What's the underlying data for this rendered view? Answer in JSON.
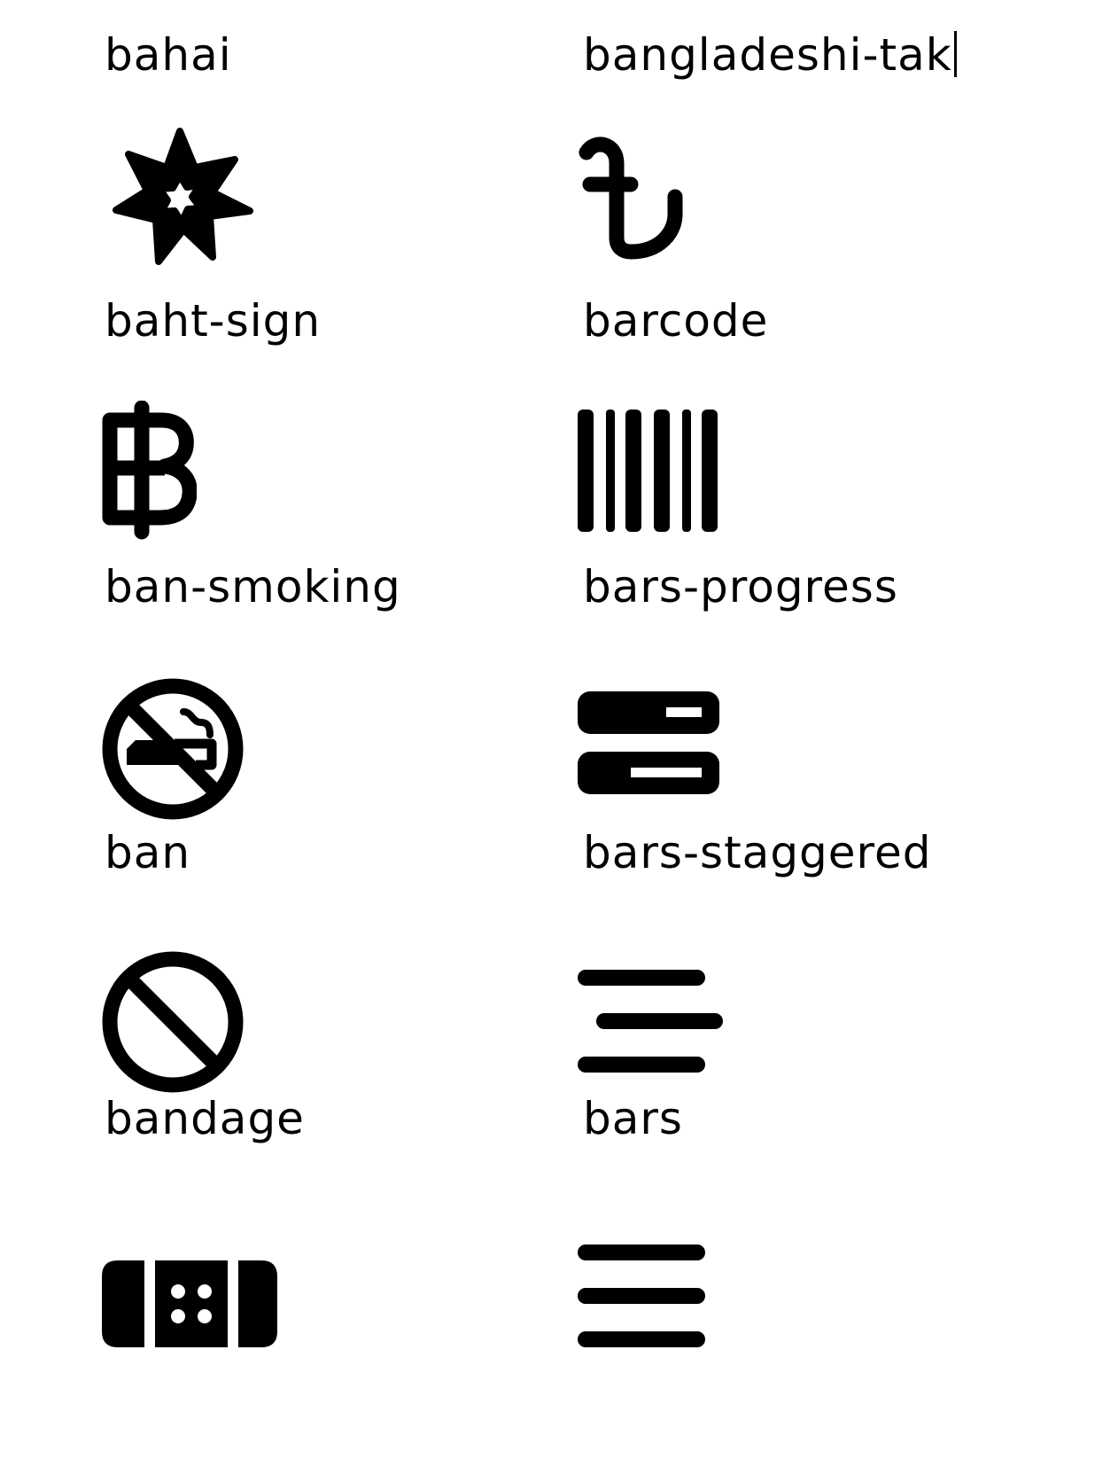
{
  "glyphs": {
    "bahai": {
      "name": "bahai"
    },
    "bangladeshi": {
      "name": "bangladeshi-tak"
    },
    "baht": {
      "name": "baht-sign"
    },
    "barcode": {
      "name": "barcode"
    },
    "ban_smoking": {
      "name": "ban-smoking"
    },
    "bars_progress": {
      "name": "bars-progress"
    },
    "ban": {
      "name": "ban"
    },
    "bars_staggered": {
      "name": "bars-staggered"
    },
    "bandage": {
      "name": "bandage"
    },
    "bars": {
      "name": "bars"
    }
  },
  "colors": {
    "ink": "#000000",
    "background": "#ffffff"
  }
}
